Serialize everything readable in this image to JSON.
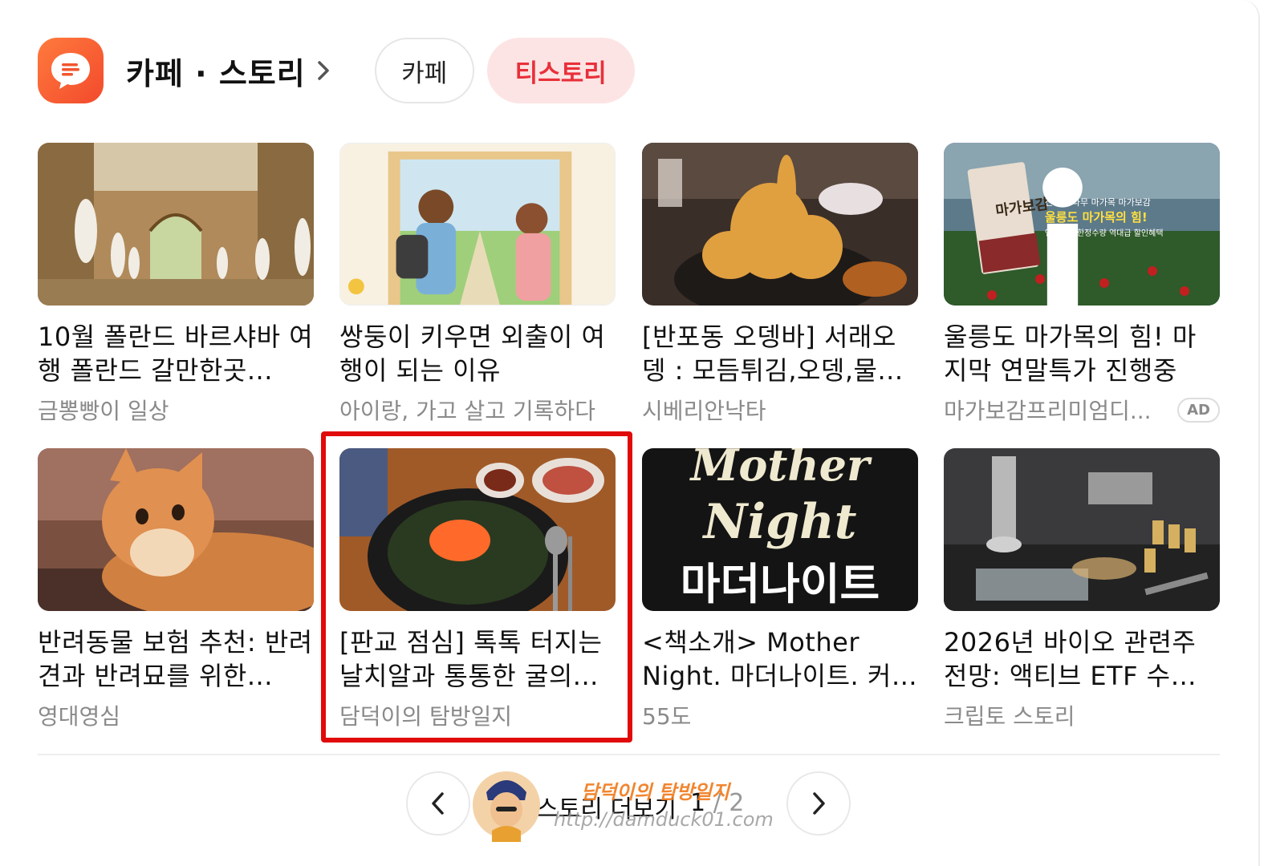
{
  "header": {
    "title": "카페 · 스토리",
    "tabs": [
      {
        "label": "카페",
        "active": false
      },
      {
        "label": "티스토리",
        "active": true
      }
    ],
    "accent_color": "#f24a2c",
    "active_tab_bg": "#fde4e4",
    "active_tab_color": "#e8303a"
  },
  "cards": [
    {
      "title": "10월 폴란드 바르샤바 여행 폴란드 갈만한곳...",
      "source": "금뽕빵이 일상",
      "thumb": "gallery-statues-image"
    },
    {
      "title": "쌍둥이 키우면 외출이 여행이 되는 이유",
      "source": "아이랑, 가고 살고 기록하다",
      "thumb": "children-illustration-image"
    },
    {
      "title": "[반포동 오뎅바] 서래오뎅 : 모듬튀김,오뎅,물...",
      "source": "시베리안낙타",
      "thumb": "tempura-image"
    },
    {
      "title": "울릉도 마가목의 힘! 마지막 연말특가 진행중",
      "source": "마가보감프리미엄디...",
      "ad": "AD",
      "thumb": "magamok-ad-image",
      "thumb_text": {
        "product": "마가보감",
        "line1": "선비의 나무 마가목 마가보감",
        "line2": "울릉도 마가목의 힘!",
        "line3": "연말연시 한정수량 역대급 할인혜택"
      }
    },
    {
      "title": "반려동물 보험 추천: 반려견과 반려묘를 위한...",
      "source": "영대영심",
      "thumb": "orange-cat-image"
    },
    {
      "title": "[판교 점심] 톡톡 터지는 날치알과 통통한 굴의...",
      "source": "담덕이의 탐방일지",
      "highlighted": true,
      "thumb": "bibimbap-image"
    },
    {
      "title": "<책소개> Mother Night. 마더나이트. 커트 보니것",
      "source": "55도",
      "thumb": "mother-night-book-image",
      "thumb_text": {
        "line1": "Mother",
        "line2": "Night",
        "line3": "마더나이트"
      }
    },
    {
      "title": "2026년 바이오 관련주 전망: 액티브 ETF 수급...",
      "source": "크립토 스토리",
      "thumb": "lab-microscope-image"
    }
  ],
  "pager": {
    "label": "스토리 더보기",
    "current": "1",
    "total": "2",
    "prev_icon": "chevron-left-icon",
    "next_icon": "chevron-right-icon"
  },
  "watermark": {
    "name": "담덕이의 탐방일지",
    "url": "http://damduck01.com"
  }
}
